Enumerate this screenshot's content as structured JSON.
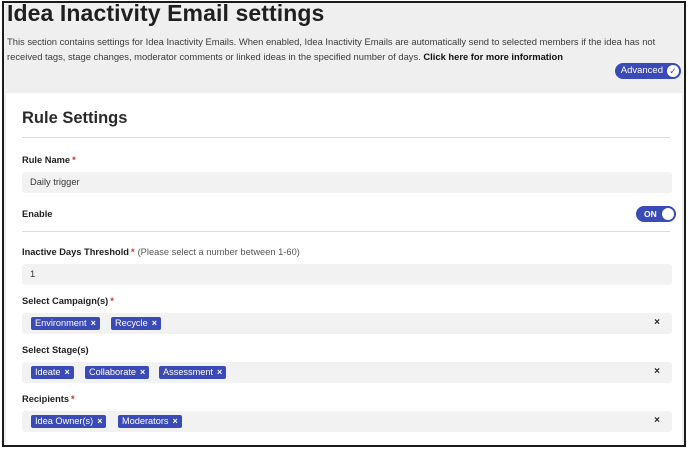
{
  "header": {
    "title": "Idea Inactivity Email settings",
    "description": "This section contains settings for Idea Inactivity Emails. When enabled, Idea Inactivity Emails are automatically send to selected members if the idea has not received tags, stage changes, moderator comments or linked ideas in the specified number of days.",
    "more_info_link": "Click here for more information",
    "advanced_label": "Advanced"
  },
  "rule": {
    "section_title": "Rule Settings",
    "rule_name_label": "Rule Name",
    "rule_name_value": "Daily trigger",
    "enable_label": "Enable",
    "enable_toggle_text": "ON",
    "inactive_days_label": "Inactive Days Threshold",
    "inactive_days_hint": "(Please select a number between 1-60)",
    "inactive_days_value": "1",
    "campaigns_label": "Select Campaign(s)",
    "campaigns": [
      "Environment",
      "Recycle"
    ],
    "stages_label": "Select Stage(s)",
    "stages": [
      "Ideate",
      "Collaborate",
      "Assessment"
    ],
    "recipients_label": "Recipients",
    "recipients": [
      "Idea Owner(s)",
      "Moderators"
    ],
    "required_mark": "*",
    "chip_remove": "×",
    "clear_all": "×"
  },
  "colors": {
    "accent": "#3a4ab6",
    "required": "#d32a2a",
    "field_bg": "#f2f2f2",
    "header_bg": "#efefef"
  },
  "icons": {
    "advanced_check": "check-icon"
  }
}
